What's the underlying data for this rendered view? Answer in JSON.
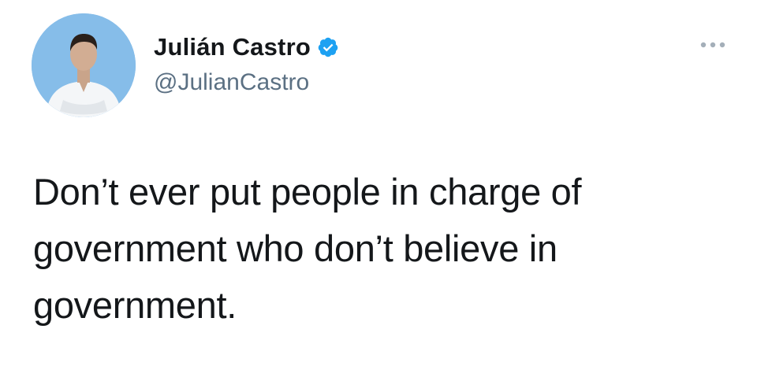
{
  "author": {
    "display_name": "Julián Castro",
    "handle": "@JulianCastro",
    "verified": true,
    "avatar_icon": "profile-photo"
  },
  "tweet": {
    "text": "Don’t ever put people in charge of government who don’t believe in government."
  },
  "icons": {
    "verified": "verified-badge-icon",
    "more": "more-options-icon"
  },
  "colors": {
    "verified_blue": "#1da1f2",
    "text": "#14171a",
    "secondary": "#5b7083"
  }
}
